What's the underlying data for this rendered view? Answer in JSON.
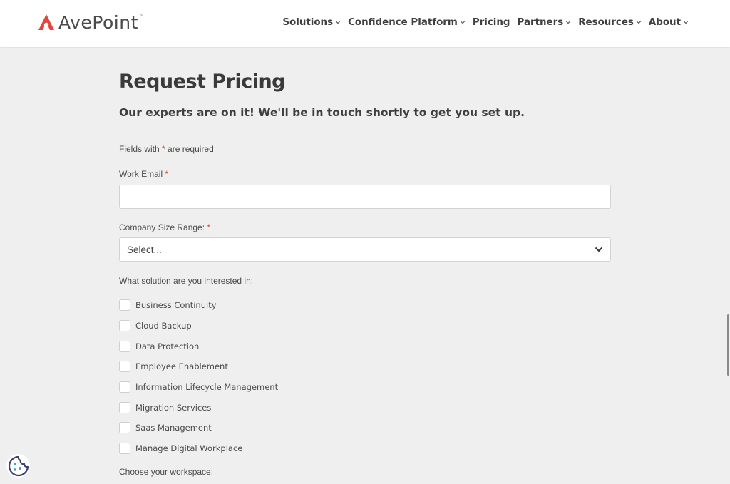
{
  "brand": {
    "name": "AvePoint",
    "accent": "#e3473b"
  },
  "nav": [
    {
      "label": "Solutions",
      "has_menu": true
    },
    {
      "label": "Confidence Platform",
      "has_menu": true
    },
    {
      "label": "Pricing",
      "has_menu": false
    },
    {
      "label": "Partners",
      "has_menu": true
    },
    {
      "label": "Resources",
      "has_menu": true
    },
    {
      "label": "About",
      "has_menu": true
    }
  ],
  "form": {
    "title": "Request Pricing",
    "subtitle": "Our experts are on it! We'll be in touch shortly to get you set up.",
    "required_note_prefix": "Fields with",
    "required_star": "*",
    "required_note_suffix": "are required",
    "work_email": {
      "label": "Work Email",
      "value": "",
      "placeholder": ""
    },
    "company_size": {
      "label": "Company Size Range:",
      "value": "Select..."
    },
    "solutions_label": "What solution are you interested in:",
    "solutions": [
      "Business Continuity",
      "Cloud Backup",
      "Data Protection",
      "Employee Enablement",
      "Information Lifecycle Management",
      "Migration Services",
      "Saas Management",
      "Manage Digital Workplace"
    ],
    "workspace_label": "Choose your workspace:"
  },
  "icons": {
    "logo": "avepoint-logo-icon",
    "cookie": "cookie-icon",
    "chevron": "chevron-down-icon"
  }
}
